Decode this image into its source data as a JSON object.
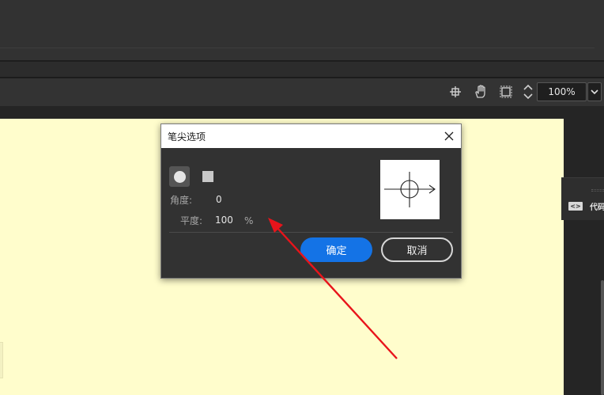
{
  "toolbar": {
    "icons": [
      "crosshair-icon",
      "hand-tool-icon",
      "clip-frame-icon"
    ],
    "zoom_value": "100%"
  },
  "side_panel": {
    "code_icon_glyph": "<>",
    "code_label": "代码"
  },
  "dialog": {
    "title": "笔尖选项",
    "tip_shapes": [
      "round",
      "square"
    ],
    "angle_label": "角度:",
    "angle_value": "0",
    "roundness_label": "平度:",
    "roundness_value": "100",
    "roundness_unit": "%",
    "ok_label": "确定",
    "cancel_label": "取消"
  },
  "colors": {
    "canvas": "#fffdcc",
    "primary_button": "#1473e6",
    "annotation_arrow": "#e8141b"
  }
}
